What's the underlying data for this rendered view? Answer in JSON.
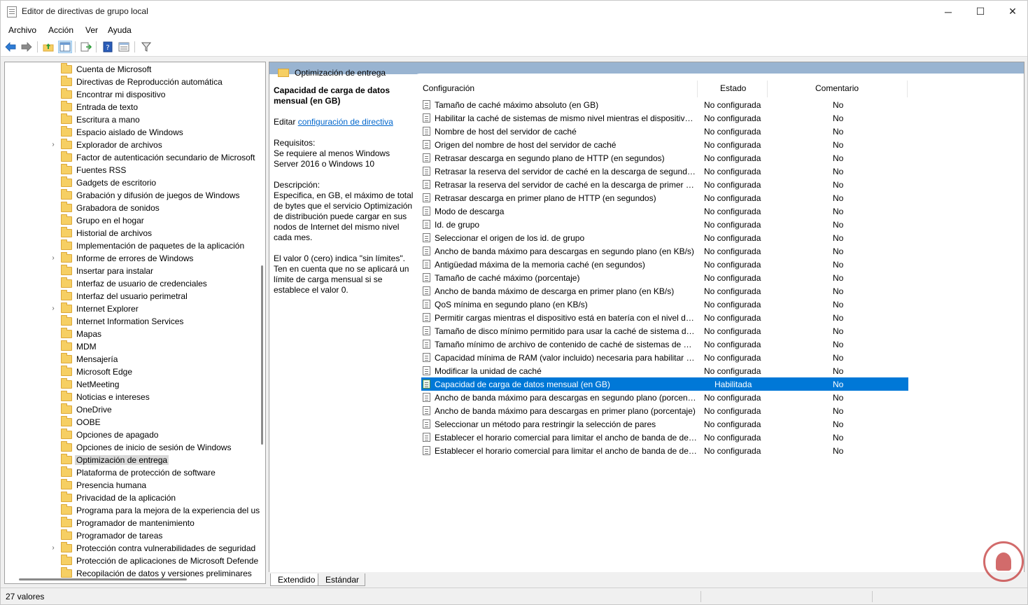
{
  "window": {
    "title": "Editor de directivas de grupo local",
    "minimize": "─",
    "maximize": "☐",
    "close": "✕"
  },
  "menu": [
    "Archivo",
    "Acción",
    "Ver",
    "Ayuda"
  ],
  "toolbar": {
    "icons": [
      "back-arrow-icon",
      "forward-arrow-icon",
      "folder-up-icon",
      "show-hide-tree-icon",
      "export-list-icon",
      "help-icon",
      "properties-view-icon",
      "filter-icon"
    ]
  },
  "tree": {
    "items": [
      {
        "label": "Cuenta de Microsoft",
        "expandable": false
      },
      {
        "label": "Directivas de Reproducción automática",
        "expandable": false
      },
      {
        "label": "Encontrar mi dispositivo",
        "expandable": false
      },
      {
        "label": "Entrada de texto",
        "expandable": false
      },
      {
        "label": "Escritura a mano",
        "expandable": false
      },
      {
        "label": "Espacio aislado de Windows",
        "expandable": false
      },
      {
        "label": "Explorador de archivos",
        "expandable": true
      },
      {
        "label": "Factor de autenticación secundario de Microsoft",
        "expandable": false
      },
      {
        "label": "Fuentes RSS",
        "expandable": false
      },
      {
        "label": "Gadgets de escritorio",
        "expandable": false
      },
      {
        "label": "Grabación y difusión de juegos de Windows",
        "expandable": false
      },
      {
        "label": "Grabadora de sonidos",
        "expandable": false
      },
      {
        "label": "Grupo en el hogar",
        "expandable": false
      },
      {
        "label": "Historial de archivos",
        "expandable": false
      },
      {
        "label": "Implementación de paquetes de la aplicación",
        "expandable": false
      },
      {
        "label": "Informe de errores de Windows",
        "expandable": true
      },
      {
        "label": "Insertar para instalar",
        "expandable": false
      },
      {
        "label": "Interfaz de usuario de credenciales",
        "expandable": false
      },
      {
        "label": "Interfaz del usuario perimetral",
        "expandable": false
      },
      {
        "label": "Internet Explorer",
        "expandable": true
      },
      {
        "label": "Internet Information Services",
        "expandable": false
      },
      {
        "label": "Mapas",
        "expandable": false
      },
      {
        "label": "MDM",
        "expandable": false
      },
      {
        "label": "Mensajería",
        "expandable": false
      },
      {
        "label": "Microsoft Edge",
        "expandable": false
      },
      {
        "label": "NetMeeting",
        "expandable": false
      },
      {
        "label": "Noticias e intereses",
        "expandable": false
      },
      {
        "label": "OneDrive",
        "expandable": false
      },
      {
        "label": "OOBE",
        "expandable": false
      },
      {
        "label": "Opciones de apagado",
        "expandable": false
      },
      {
        "label": "Opciones de inicio de sesión de Windows",
        "expandable": false
      },
      {
        "label": "Optimización de entrega",
        "expandable": false,
        "selected": true
      },
      {
        "label": "Plataforma de protección de software",
        "expandable": false
      },
      {
        "label": "Presencia humana",
        "expandable": false
      },
      {
        "label": "Privacidad de la aplicación",
        "expandable": false
      },
      {
        "label": "Programa para la mejora de la experiencia del us",
        "expandable": false
      },
      {
        "label": "Programador de mantenimiento",
        "expandable": false
      },
      {
        "label": "Programador de tareas",
        "expandable": false
      },
      {
        "label": "Protección contra vulnerabilidades de seguridad",
        "expandable": true
      },
      {
        "label": "Protección de aplicaciones de Microsoft Defende",
        "expandable": false
      },
      {
        "label": "Recopilación de datos y versiones preliminares",
        "expandable": false
      }
    ]
  },
  "detail": {
    "header": "Optimización de entrega",
    "desc_title": "Capacidad de carga de datos mensual (en GB)",
    "edit_prefix": "Editar ",
    "edit_link": "configuración de directiva",
    "requirements_label": "Requisitos:",
    "requirements_text": "Se requiere al menos Windows Server 2016 o Windows 10",
    "description_label": "Descripción:",
    "description_text": "Especifica, en GB, el máximo de total de bytes que el servicio Optimización de distribución puede cargar en sus nodos de Internet del mismo nivel cada mes.",
    "note_text": "El valor 0 (cero) indica \"sin límites\". Ten en cuenta que no se aplicará un límite de carga mensual si se establece el valor 0."
  },
  "list": {
    "columns": {
      "config": "Configuración",
      "state": "Estado",
      "comment": "Comentario"
    },
    "rows": [
      {
        "name": "Tamaño de caché máximo absoluto (en GB)",
        "state": "No configurada",
        "comment": "No"
      },
      {
        "name": "Habilitar la caché de sistemas de mismo nivel mientras el dispositivo se conecta mediante VPN",
        "state": "No configurada",
        "comment": "No"
      },
      {
        "name": "Nombre de host del servidor de caché",
        "state": "No configurada",
        "comment": "No"
      },
      {
        "name": "Origen del nombre de host del servidor de caché",
        "state": "No configurada",
        "comment": "No"
      },
      {
        "name": "Retrasar descarga en segundo plano de HTTP (en segundos)",
        "state": "No configurada",
        "comment": "No"
      },
      {
        "name": "Retrasar la reserva del servidor de caché en la descarga de segundo plano (en segundos)",
        "state": "No configurada",
        "comment": "No"
      },
      {
        "name": "Retrasar la reserva del servidor de caché en la descarga de primer plano (en segundos)",
        "state": "No configurada",
        "comment": "No"
      },
      {
        "name": "Retrasar descarga en primer plano de HTTP (en segundos)",
        "state": "No configurada",
        "comment": "No"
      },
      {
        "name": "Modo de descarga",
        "state": "No configurada",
        "comment": "No"
      },
      {
        "name": "Id. de grupo",
        "state": "No configurada",
        "comment": "No"
      },
      {
        "name": "Seleccionar el origen de los id. de grupo",
        "state": "No configurada",
        "comment": "No"
      },
      {
        "name": "Ancho de banda máximo para descargas en segundo plano (en KB/s)",
        "state": "No configurada",
        "comment": "No"
      },
      {
        "name": "Antigüedad máxima de la memoria caché (en segundos)",
        "state": "No configurada",
        "comment": "No"
      },
      {
        "name": "Tamaño de caché máximo (porcentaje)",
        "state": "No configurada",
        "comment": "No"
      },
      {
        "name": "Ancho de banda máximo de descarga en primer plano (en KB/s)",
        "state": "No configurada",
        "comment": "No"
      },
      {
        "name": "QoS mínima en segundo plano (en KB/s)",
        "state": "No configurada",
        "comment": "No"
      },
      {
        "name": "Permitir cargas mientras el dispositivo está en batería con el nivel de batería establecido",
        "state": "No configurada",
        "comment": "No"
      },
      {
        "name": "Tamaño de disco mínimo permitido para usar la caché de sistema de mismo nivel (en GB)",
        "state": "No configurada",
        "comment": "No"
      },
      {
        "name": "Tamaño mínimo de archivo de contenido de caché de sistemas de mismo nivel (en MB)",
        "state": "No configurada",
        "comment": "No"
      },
      {
        "name": "Capacidad mínima de RAM (valor incluido) necesaria para habilitar el almacenamiento en caché",
        "state": "No configurada",
        "comment": "No"
      },
      {
        "name": "Modificar la unidad de caché",
        "state": "No configurada",
        "comment": "No"
      },
      {
        "name": "Capacidad de carga de datos mensual (en GB)",
        "state": "Habilitada",
        "comment": "No",
        "selected": true
      },
      {
        "name": "Ancho de banda máximo para descargas en segundo plano (porcentaje)",
        "state": "No configurada",
        "comment": "No"
      },
      {
        "name": "Ancho de banda máximo para descargas en primer plano (porcentaje)",
        "state": "No configurada",
        "comment": "No"
      },
      {
        "name": "Seleccionar un método para restringir la selección de pares",
        "state": "No configurada",
        "comment": "No"
      },
      {
        "name": "Establecer el horario comercial para limitar el ancho de banda de descarga en segundo plano",
        "state": "No configurada",
        "comment": "No"
      },
      {
        "name": "Establecer el horario comercial para limitar el ancho de banda de descarga en primer plano",
        "state": "No configurada",
        "comment": "No"
      }
    ]
  },
  "tabs": [
    "Extendido",
    "Estándar"
  ],
  "status": "27 valores"
}
